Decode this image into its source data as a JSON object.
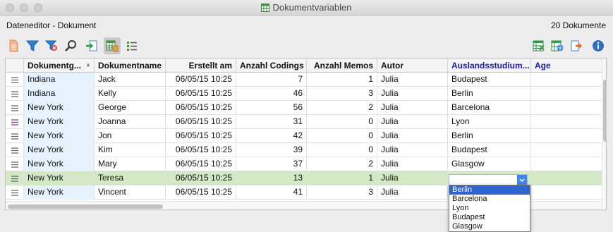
{
  "window": {
    "title": "Dokumentvariablen"
  },
  "header": {
    "context_title": "Dateneditor - Dokument",
    "document_count": "20 Dokumente"
  },
  "toolbar_icons": [
    "new-document-icon",
    "filter-icon",
    "clear-filter-icon",
    "search-icon",
    "import-icon",
    "table-view-icon",
    "list-view-icon",
    "excel-export-icon",
    "html-export-icon",
    "export-icon",
    "info-icon"
  ],
  "table": {
    "columns": [
      "Dokumentg...",
      "Dokumentname",
      "Erstellt am",
      "Anzahl Codings",
      "Anzahl Memos",
      "Autor",
      "Auslandsstudium...",
      "Age"
    ],
    "rows": [
      [
        "Indiana",
        "Jack",
        "06/05/15 10:25",
        "7",
        "1",
        "Julia",
        "Budapest",
        ""
      ],
      [
        "Indiana",
        "Kelly",
        "06/05/15 10:25",
        "46",
        "3",
        "Julia",
        "Berlin",
        ""
      ],
      [
        "New York",
        "George",
        "06/05/15 10:25",
        "56",
        "2",
        "Julia",
        "Barcelona",
        ""
      ],
      [
        "New York",
        "Joanna",
        "06/05/15 10:25",
        "31",
        "0",
        "Julia",
        "Lyon",
        ""
      ],
      [
        "New York",
        "Jon",
        "06/05/15 10:25",
        "42",
        "0",
        "Julia",
        "Berlin",
        ""
      ],
      [
        "New York",
        "Kim",
        "06/05/15 10:25",
        "39",
        "0",
        "Julia",
        "Budapest",
        ""
      ],
      [
        "New York",
        "Mary",
        "06/05/15 10:25",
        "37",
        "2",
        "Julia",
        "Glasgow",
        ""
      ],
      [
        "New York",
        "Teresa",
        "06/05/15 10:25",
        "13",
        "1",
        "Julia",
        "",
        ""
      ],
      [
        "New York",
        "Vincent",
        "06/05/15 10:25",
        "41",
        "3",
        "Julia",
        "Berlin",
        ""
      ]
    ]
  },
  "dropdown": {
    "options": [
      "Berlin",
      "Barcelona",
      "Lyon",
      "Budapest",
      "Glasgow"
    ],
    "selected": "Berlin"
  },
  "colors": {
    "selected_row": "#d3e8c4",
    "group_column": "#e6f2fd",
    "variable_header": "#1a1aa8",
    "dropdown_highlight": "#2f63cf"
  }
}
